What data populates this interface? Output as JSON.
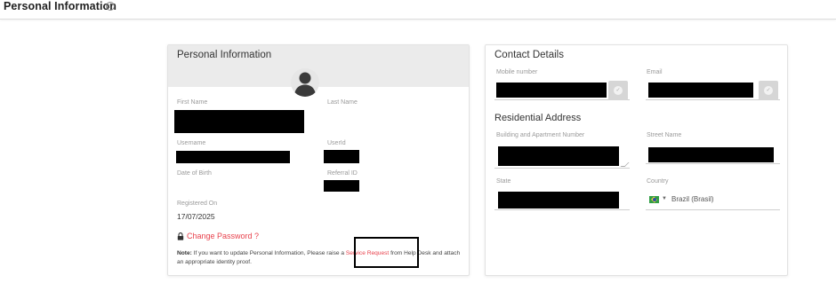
{
  "header": {
    "title": "Personal Information",
    "info_icon": "info-icon"
  },
  "personal": {
    "title": "Personal Information",
    "first_name_label": "First Name",
    "last_name_label": "Last Name",
    "username_label": "Username",
    "userid_label": "UserId",
    "dob_label": "Date of Birth",
    "referral_label": "Referral ID",
    "registered_label": "Registered On",
    "registered_value": "17/07/2025",
    "change_password": "Change Password ?",
    "note_bold": "Note:",
    "note_text_1": " If you want to update Personal Information, Please raise a ",
    "note_link": "Service Request",
    "note_text_2": " from Help Desk and attach an appropriate identity proof."
  },
  "contact": {
    "title": "Contact Details",
    "mobile_label": "Mobile number",
    "email_label": "Email",
    "residential_title": "Residential Address",
    "building_label": "Building and Apartment Number",
    "street_label": "Street Name",
    "state_label": "State",
    "country_label": "Country",
    "country_value": "Brazil (Brasil)"
  },
  "colors": {
    "accent_red": "#e8414c",
    "header_grey": "#ebebeb"
  }
}
